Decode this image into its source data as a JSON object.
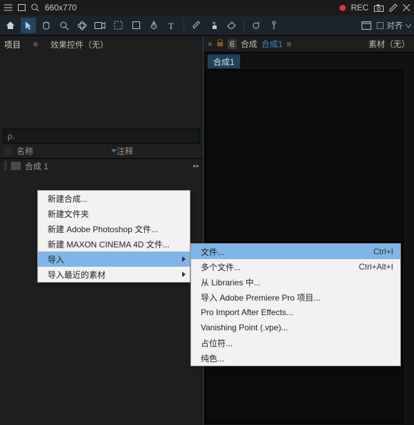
{
  "sysbar": {
    "search_text": "660x770",
    "rec_label": "REC"
  },
  "toolbar": {
    "align_label": "对齐"
  },
  "project_panel": {
    "tab_label": "项目",
    "effects_label": "效果控件（无）",
    "search_placeholder": "ρ.",
    "col_name": "名称",
    "col_notes": "注释",
    "row1_name": "合成 1"
  },
  "viewer": {
    "num": "6",
    "label_comp": "合成",
    "linked_comp": "合成1",
    "material_label": "素材（无）",
    "comp_tab": "合成1"
  },
  "ctx1": {
    "i0": "新建合成...",
    "i1": "新建文件夹",
    "i2": "新建 Adobe Photoshop 文件...",
    "i3": "新建 MAXON CINEMA 4D 文件...",
    "i4": "导入",
    "i5": "导入最近的素材"
  },
  "ctx2": {
    "i0": "文件...",
    "s0": "Ctrl+I",
    "i1": "多个文件...",
    "s1": "Ctrl+Alt+I",
    "i2": "从 Libraries 中...",
    "i3": "导入 Adobe Premiere Pro 项目...",
    "i4": "Pro Import After Effects...",
    "i5": "Vanishing Point (.vpe)...",
    "i6": "占位符...",
    "i7": "纯色..."
  }
}
